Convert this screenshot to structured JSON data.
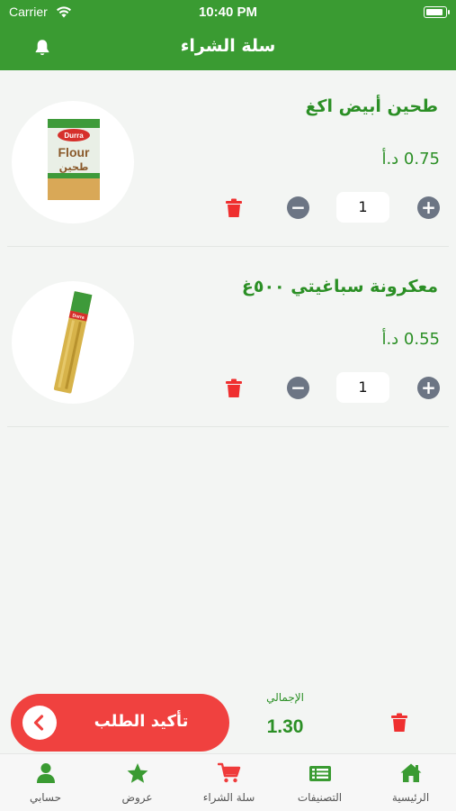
{
  "status_bar": {
    "carrier": "Carrier",
    "time": "10:40 PM"
  },
  "header": {
    "title": "سلة الشراء"
  },
  "cart": {
    "items": [
      {
        "name": "طحين أبيض اكغ",
        "price": "0.75 د.أ",
        "quantity": "1",
        "package_text": [
          "Durra",
          "Flour",
          "طحين"
        ]
      },
      {
        "name": "معكرونة سباغيتي ٥٠٠غ",
        "price": "0.55 د.أ",
        "quantity": "1",
        "package_text": [
          "Durra"
        ]
      }
    ],
    "total_label": "الإجمالي",
    "total_value": "1.30",
    "confirm_label": "تأكيد الطلب"
  },
  "tabs": [
    {
      "label": "الرئيسية",
      "icon": "home-icon"
    },
    {
      "label": "التصنيفات",
      "icon": "list-icon"
    },
    {
      "label": "سلة الشراء",
      "icon": "cart-icon"
    },
    {
      "label": "عروض",
      "icon": "star-icon"
    },
    {
      "label": "حسابي",
      "icon": "user-icon"
    }
  ],
  "colors": {
    "primary": "#3a9b32",
    "text_green": "#2b8f25",
    "danger": "#f0413f",
    "stepper": "#6c7584",
    "tab_icon": "#3a9b32",
    "cart_icon": "#ef3b3b"
  }
}
